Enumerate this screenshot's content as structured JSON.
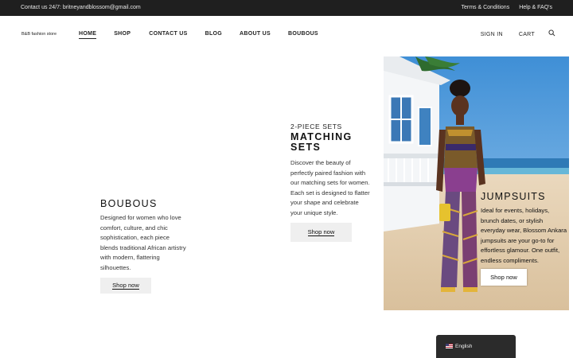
{
  "topbar": {
    "contact": "Contact us 24/7: britneyandblossom@gmail.com",
    "links": [
      "Terms & Conditions",
      "Help & FAQ's"
    ]
  },
  "header": {
    "logo": "B&B fashion store",
    "nav": [
      "HOME",
      "SHOP",
      "CONTACT US",
      "BLOG",
      "ABOUT US",
      "BOUBOUS"
    ],
    "active_nav": "HOME",
    "sign_in": "SIGN IN",
    "cart": "CART",
    "search_icon": "search-icon"
  },
  "boubous": {
    "title": "BOUBOUS",
    "description": "Designed for women who love comfort, culture, and chic sophistication, each piece blends traditional African artistry with modern, flattering silhouettes.",
    "button": "Shop now"
  },
  "sets": {
    "kicker": "2-PIECE SETS",
    "title": "MATCHING SETS",
    "description": "Discover the beauty of perfectly paired fashion with our matching sets for women. Each set is designed to flatter your shape and celebrate your unique style.",
    "button": "Shop now"
  },
  "jumpsuits": {
    "title": "JUMPSUITS",
    "description": "Ideal for events, holidays, brunch dates, or stylish everyday wear, Blossom Ankara jumpsuits are your go-to for effortless glamour. One outfit, endless compliments.",
    "button": "Shop now",
    "image_icon": "woman-in-jumpsuit-on-beach-photo"
  },
  "language": {
    "label": "English",
    "flag_icon": "us-flag-icon"
  },
  "colors": {
    "topbar_bg": "#1f1f1f",
    "button_bg": "#efefef",
    "lang_bg": "#2b2b2b"
  }
}
